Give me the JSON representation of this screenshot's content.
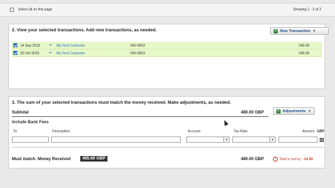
{
  "top": {
    "select_all_label": "Select all on this page",
    "showing": "Showing 1 - 2 of 2"
  },
  "section2": {
    "heading": "2. View your selected transactions. Add new transactions, as needed.",
    "new_button_label": "New Transaction",
    "rows": [
      {
        "checked": true,
        "date": "14 Sep 2015",
        "customer": "My First Customer",
        "invoice": "INV-0002",
        "amount": "240.00"
      },
      {
        "checked": true,
        "date": "20 Oct 2015",
        "customer": "My First Customer",
        "invoice": "INV-0003",
        "amount": "240.00"
      }
    ]
  },
  "section3": {
    "heading": "3. The sum of your selected transactions must match the money received. Make adjustments, as needed.",
    "subtotal_label": "Subtotal",
    "subtotal_value": "480.00 GBP",
    "adjustments_label": "Adjustments",
    "bank_fees_label": "Include Bank Fees",
    "columns": {
      "to": "To",
      "description": "Description",
      "account": "Account",
      "tax_rate": "Tax Rate",
      "amount": "Amount",
      "currency": "GBP"
    },
    "must_match_label": "Must match: Money Received",
    "money_received": "465.60 GBP",
    "total_value": "480.00 GBP",
    "out_by_label": "Total is out by:",
    "out_by_value": "-14.40"
  }
}
